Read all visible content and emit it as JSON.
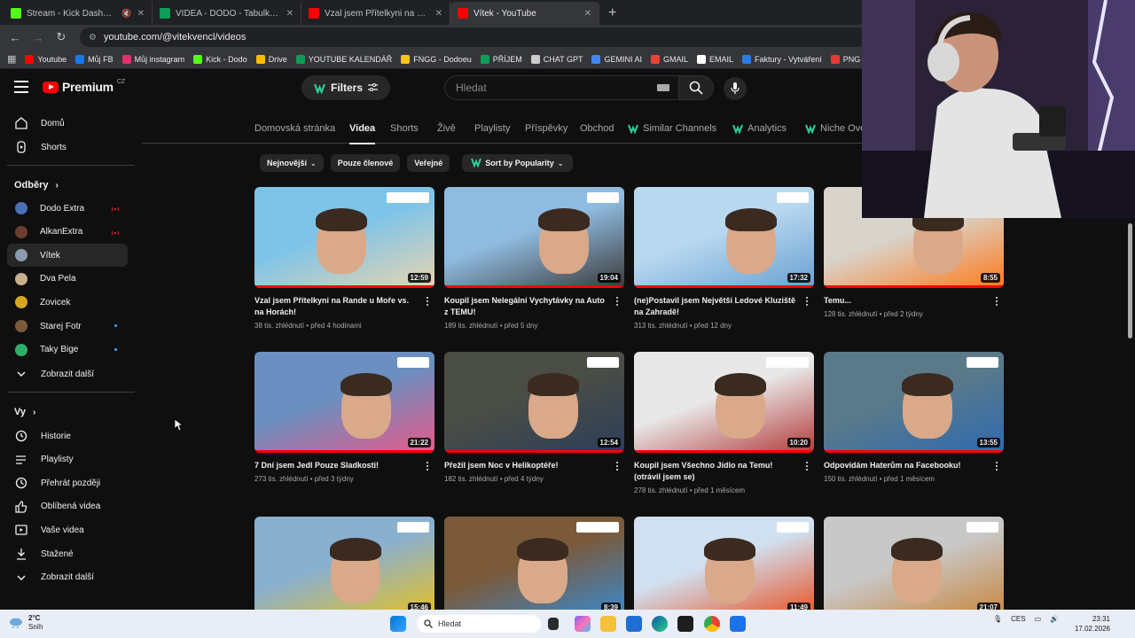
{
  "browser": {
    "tabs": [
      {
        "title": "Stream - Kick Dashboard",
        "color": "#53fc18",
        "muted": true
      },
      {
        "title": "VIDEA - DODO - Tabulky Googl",
        "color": "#0f9d58",
        "muted": false
      },
      {
        "title": "Vzal jsem Přítelkyni na Rande u",
        "color": "#ff0000",
        "muted": false
      },
      {
        "title": "Vítek - YouTube",
        "color": "#ff0000",
        "muted": false
      }
    ],
    "url": "youtube.com/@vitekvencl/videos",
    "bookmarks": [
      {
        "label": "Youtube",
        "color": "#ff0000"
      },
      {
        "label": "Můj FB",
        "color": "#1877f2"
      },
      {
        "label": "Můj instagram",
        "color": "#e1306c"
      },
      {
        "label": "Kick - Dodo",
        "color": "#53fc18"
      },
      {
        "label": "Drive",
        "color": "#fbbc04"
      },
      {
        "label": "YOUTUBE KALENDÁŘ",
        "color": "#0f9d58"
      },
      {
        "label": "FNGG - Dodoeu",
        "color": "#f5c518"
      },
      {
        "label": "PŘÍJEM",
        "color": "#0f9d58"
      },
      {
        "label": "CHAT GPT",
        "color": "#cccccc"
      },
      {
        "label": "GEMINI AI",
        "color": "#4285f4"
      },
      {
        "label": "GMAIL",
        "color": "#ea4335"
      },
      {
        "label": "EMAIL",
        "color": "#ffffff"
      },
      {
        "label": "Faktury - Vytváření",
        "color": "#2b7de9"
      },
      {
        "label": "PNG to PDF",
        "color": "#e53935"
      }
    ]
  },
  "youtube": {
    "logo": "Premium",
    "logo_region": "CZ",
    "filters_label": "Filters",
    "search_placeholder": "Hledat"
  },
  "sidebar": {
    "main": [
      {
        "label": "Domů",
        "icon": "home-icon"
      },
      {
        "label": "Shorts",
        "icon": "shorts-icon"
      }
    ],
    "subs_heading": "Odběry",
    "subscriptions": [
      {
        "label": "Dodo Extra",
        "avatar": "#4a6fb5",
        "live": true
      },
      {
        "label": "AlkanExtra",
        "avatar": "#6b3d2e",
        "live": true
      },
      {
        "label": "Vítek",
        "avatar": "#8a9bb0",
        "selected": true
      },
      {
        "label": "Dva Pela",
        "avatar": "#c9b08a"
      },
      {
        "label": "Zovicek",
        "avatar": "#d6a520"
      },
      {
        "label": "Starej Fotr",
        "avatar": "#7a5a3a",
        "dot": true
      },
      {
        "label": "Taky Bige",
        "avatar": "#2fae6a",
        "dot": true
      }
    ],
    "subs_more": "Zobrazit další",
    "you_heading": "Vy",
    "you": [
      {
        "label": "Historie",
        "icon": "history-icon"
      },
      {
        "label": "Playlisty",
        "icon": "playlist-icon"
      },
      {
        "label": "Přehrát později",
        "icon": "watch-later-icon"
      },
      {
        "label": "Oblíbená videa",
        "icon": "like-icon"
      },
      {
        "label": "Vaše videa",
        "icon": "your-videos-icon"
      },
      {
        "label": "Stažené",
        "icon": "download-icon"
      },
      {
        "label": "Zobrazit další",
        "icon": "chevron-down-icon"
      }
    ]
  },
  "channel_tabs": [
    {
      "label": "Domovská stránka"
    },
    {
      "label": "Videa",
      "selected": true
    },
    {
      "label": "Shorts"
    },
    {
      "label": "Živě"
    },
    {
      "label": "Playlisty"
    },
    {
      "label": "Příspěvky"
    },
    {
      "label": "Obchod"
    },
    {
      "label": "Similar Channels",
      "ext": true
    },
    {
      "label": "Analytics",
      "ext": true
    },
    {
      "label": "Niche Ove",
      "ext": true
    }
  ],
  "chips": [
    {
      "label": "Nejnovější",
      "dropdown": true
    },
    {
      "label": "Pouze členové"
    },
    {
      "label": "Veřejné"
    }
  ],
  "sort_chip": "Sort by Popularity",
  "videos": [
    {
      "title": "Vzal jsem Přítelkyni na Rande u Moře vs. na Horách!",
      "views": "38 tis. zhlédnutí",
      "age": "před 4 hodinami",
      "duration": "12:59",
      "bg1": "#7ec4e8",
      "bg2": "#e8d4b0"
    },
    {
      "title": "Koupil jsem Nelegální Vychytávky na Auto z TEMU!",
      "views": "189 tis. zhlédnutí",
      "age": "před 5 dny",
      "duration": "19:04",
      "bg1": "#8fbbe0",
      "bg2": "#3a3a3a"
    },
    {
      "title": "(ne)Postavil jsem Největší Ledové Kluziště na Zahradě!",
      "views": "313 tis. zhlédnutí",
      "age": "před 12 dny",
      "duration": "17:32",
      "bg1": "#b8d8f0",
      "bg2": "#6aa0d0"
    },
    {
      "title": "Temu...",
      "views": "128 tis. zhlédnutí",
      "age": "před 2 týdny",
      "duration": "8:55",
      "bg1": "#d8d4cc",
      "bg2": "#ff7a1a"
    },
    {
      "title": "7 Dní jsem Jedl Pouze Sladkosti!",
      "views": "273 tis. zhlédnutí",
      "age": "před 3 týdny",
      "duration": "21:22",
      "bg1": "#6a8fc0",
      "bg2": "#e85a8a"
    },
    {
      "title": "Přežil jsem Noc v Helikoptéře!",
      "views": "182 tis. zhlédnutí",
      "age": "před 4 týdny",
      "duration": "12:54",
      "bg1": "#4a4d45",
      "bg2": "#2c3e5a"
    },
    {
      "title": "Koupil jsem Všechno Jídlo na Temu! (otrávil jsem se)",
      "views": "278 tis. zhlédnutí",
      "age": "před 1 měsícem",
      "duration": "10:20",
      "bg1": "#e8e8e8",
      "bg2": "#b33a3a"
    },
    {
      "title": "Odpovídám Haterům na Facebooku!",
      "views": "150 tis. zhlédnutí",
      "age": "před 1 měsícem",
      "duration": "13:55",
      "bg1": "#5a7a8a",
      "bg2": "#2e6ab0"
    },
    {
      "title": "",
      "views": "",
      "age": "",
      "duration": "15:46",
      "bg1": "#8ab0d0",
      "bg2": "#e6c020"
    },
    {
      "title": "",
      "views": "",
      "age": "",
      "duration": "8:39",
      "bg1": "#7a5a3a",
      "bg2": "#3a8ad0"
    },
    {
      "title": "",
      "views": "",
      "age": "",
      "duration": "11:49",
      "bg1": "#d0e0f0",
      "bg2": "#e85020"
    },
    {
      "title": "",
      "views": "",
      "age": "",
      "duration": "21:07",
      "bg1": "#c8c8c8",
      "bg2": "#c8853a"
    }
  ],
  "taskbar": {
    "temp": "2°C",
    "weather": "Sníh",
    "search": "Hledat",
    "lang": "CES",
    "time": "23:31",
    "date": "17.02.2026"
  }
}
